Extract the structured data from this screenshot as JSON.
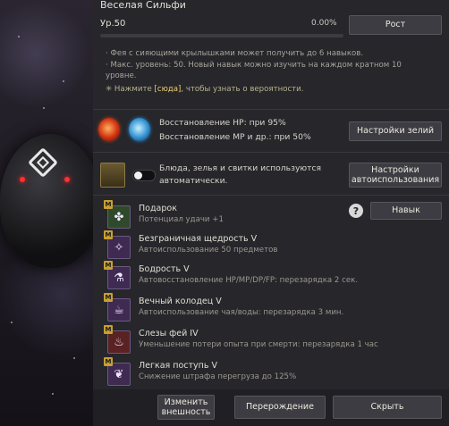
{
  "header": {
    "name": "Веселая Сильфи",
    "level": "Ур.50",
    "xp_percent": "0.00%",
    "xp_fraction": 0.0,
    "grow_button": "Рост"
  },
  "info": {
    "line1": "· Фея с сияющими крылышками может получить до 6 навыков.",
    "line2": "· Макс. уровень: 50. Новый навык можно изучить на каждом кратном 10",
    "line3": "уровне.",
    "hint_prefix": "✳ Нажмите ",
    "hint_link": "[сюда]",
    "hint_suffix": ", чтобы узнать о вероятности."
  },
  "potions": {
    "hp_text": "Восстановление HP: при 95%",
    "mp_text": "Восстановление MP и др.: при 50%",
    "settings_button": "Настройки зелий",
    "hp_icon": "hp-potion-icon",
    "mp_icon": "mp-potion-icon"
  },
  "auto": {
    "text_line1": "Блюда, зелья и свитки используются",
    "text_line2": "автоматически.",
    "button_line1": "Настройки",
    "button_line2": "автоиспользования",
    "toggle_on": false
  },
  "skills": {
    "badge": "M",
    "skill_button": "Навык",
    "help_symbol": "?",
    "items": [
      {
        "name": "Подарок",
        "desc": "Потенциал удачи +1",
        "icon": "clover-icon",
        "glyph": "✤",
        "color": "#2f4a2a"
      },
      {
        "name": "Безграничная щедрость V",
        "desc": "Автоиспользование 50 предметов",
        "icon": "fairy-icon",
        "glyph": "✧",
        "color": "#3f2a52"
      },
      {
        "name": "Бодрость V",
        "desc": "Автовосстановление HP/MP/DP/FP: перезарядка 2 сек.",
        "icon": "flask-icon",
        "glyph": "⚗",
        "color": "#3f2a52"
      },
      {
        "name": "Вечный колодец V",
        "desc": "Автоиспользование чая/воды: перезарядка 3 мин.",
        "icon": "teacup-icon",
        "glyph": "☕",
        "color": "#3f2a52"
      },
      {
        "name": "Слезы фей IV",
        "desc": "Уменьшение потери опыта при смерти: перезарядка 1 час",
        "icon": "tears-icon",
        "glyph": "♨",
        "color": "#5a2222"
      },
      {
        "name": "Легкая поступь V",
        "desc": "Снижение штрафа перегруза до 125%",
        "icon": "feather-icon",
        "glyph": "❦",
        "color": "#3f2a52"
      }
    ]
  },
  "footer": {
    "appearance_line1": "Изменить",
    "appearance_line2": "внешность",
    "rebirth": "Перерождение",
    "hide": "Скрыть"
  }
}
